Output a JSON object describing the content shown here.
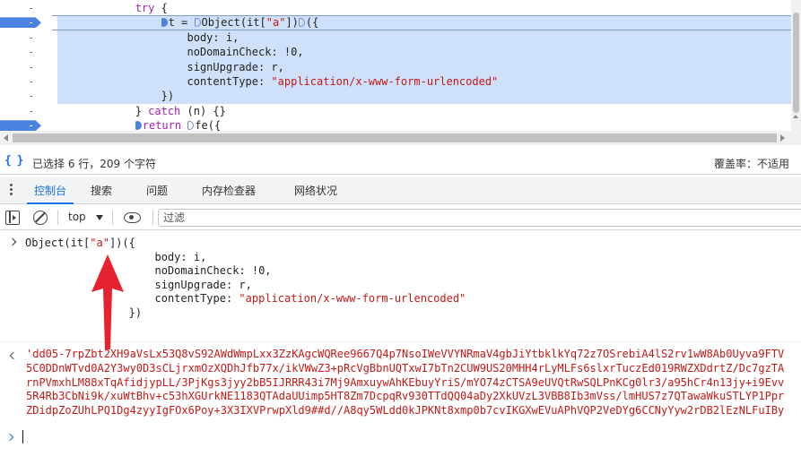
{
  "code": {
    "lines": [
      {
        "segments": [
          {
            "t": "            ",
            "c": "plain"
          },
          {
            "t": "try",
            "c": "kw"
          },
          {
            "t": " {",
            "c": "plain"
          }
        ]
      },
      {
        "segments": [
          {
            "t": "                ",
            "c": "plain"
          },
          {
            "bp": "filled"
          },
          {
            "t": "t = ",
            "c": "plain"
          },
          {
            "bp": "empty"
          },
          {
            "t": "Object(it[",
            "c": "plain"
          },
          {
            "t": "\"a\"",
            "c": "str"
          },
          {
            "t": "])",
            "c": "plain"
          },
          {
            "bp": "empty"
          },
          {
            "t": "({",
            "c": "plain"
          }
        ]
      },
      {
        "segments": [
          {
            "t": "                    body: i,",
            "c": "plain"
          }
        ]
      },
      {
        "segments": [
          {
            "t": "                    noDomainCheck: !0,",
            "c": "plain"
          }
        ]
      },
      {
        "segments": [
          {
            "t": "                    signUpgrade: r,",
            "c": "plain"
          }
        ]
      },
      {
        "segments": [
          {
            "t": "                    contentType: ",
            "c": "plain"
          },
          {
            "t": "\"application/x-www-form-urlencoded\"",
            "c": "str"
          }
        ]
      },
      {
        "segments": [
          {
            "t": "                })",
            "c": "plain"
          }
        ]
      },
      {
        "segments": [
          {
            "t": "            } ",
            "c": "plain"
          },
          {
            "t": "catch",
            "c": "kw"
          },
          {
            "t": " (n) {}",
            "c": "plain"
          }
        ]
      },
      {
        "segments": [
          {
            "t": "            ",
            "c": "plain"
          },
          {
            "bp": "filled"
          },
          {
            "t": "return",
            "c": "kw"
          },
          {
            "t": " ",
            "c": "plain"
          },
          {
            "bp": "empty"
          },
          {
            "t": "fe({",
            "c": "plain"
          }
        ]
      }
    ],
    "gutter_dash": "-"
  },
  "status": {
    "selection": "已选择 6 行，209 个字符",
    "coverage": "覆盖率：不适用"
  },
  "drawer_tabs": [
    {
      "label": "控制台",
      "active": true
    },
    {
      "label": "搜索",
      "active": false
    },
    {
      "label": "问题",
      "active": false
    },
    {
      "label": "内存检查器",
      "active": false
    },
    {
      "label": "网络状况",
      "active": false
    }
  ],
  "toolbar": {
    "context": "top",
    "filter_placeholder": "过滤"
  },
  "console": {
    "input_lines": [
      [
        {
          "t": "Object(it[",
          "c": "plain"
        },
        {
          "t": "\"a\"",
          "c": "str"
        },
        {
          "t": "])({",
          "c": "plain"
        }
      ],
      [
        {
          "t": "                    body: i,",
          "c": "plain"
        }
      ],
      [
        {
          "t": "                    noDomainCheck: !0,",
          "c": "plain"
        }
      ],
      [
        {
          "t": "                    signUpgrade: r,",
          "c": "plain"
        }
      ],
      [
        {
          "t": "                    contentType: ",
          "c": "plain"
        },
        {
          "t": "\"application/x-www-form-urlencoded\"",
          "c": "str"
        }
      ],
      [
        {
          "t": "                })",
          "c": "plain"
        }
      ]
    ],
    "result_lines": [
      "'dd05-7rpZbt2XH9aVsLx53Q8vS92AWdWmpLxx3ZzKAgcWQRee9667Q4p7NsoIWeVVYNRmaV4gbJiYtbklkYq72z7OSrebiA4lS2rv1wW8Ab0Uyva9FTV",
      "5C0DDnWTvd0A2Y3wy0D3sCLjrxmOzXQDhJfb77x/ikVWwZ3+pRcVgBbnUQTxwI7bTn2CUW9US20MHH4rLyMLFs6slxrTuczEd019RWZXDdrtZ/Dc7gzTA",
      "rnPVmxhLM88xTqAfidjypLL/3PjKgs3jyy2bB5IJRRR43i7Mj9AmxuywAhKEbuyYriS/mYO74zCTSA9eUVQtRwSQLPnKCg0lr3/a95hCr4n13jy+i9Evv",
      "5R4Rb3CbNi9k/xuWtBhv+c53hXGUrkNE1183QTAdaUUimp5HT8Zm7DcpqRv930TTdQQ04aDy2XkUVzL3VBB8Ib3mVss/lmHUS7z7QTawaWkuSTLYP1Ppr",
      "ZDidpZoZUhLPQ1Dg4zyyIgFOx6Poy+3X3IXVPrwpXld9##d//A8qy5WLdd0kJPKNt8xmp0b7cvIKGXwEVuAPhVQP2VeDYg6CCNyYyw2rDB2lEzNLFuIBy"
    ]
  }
}
